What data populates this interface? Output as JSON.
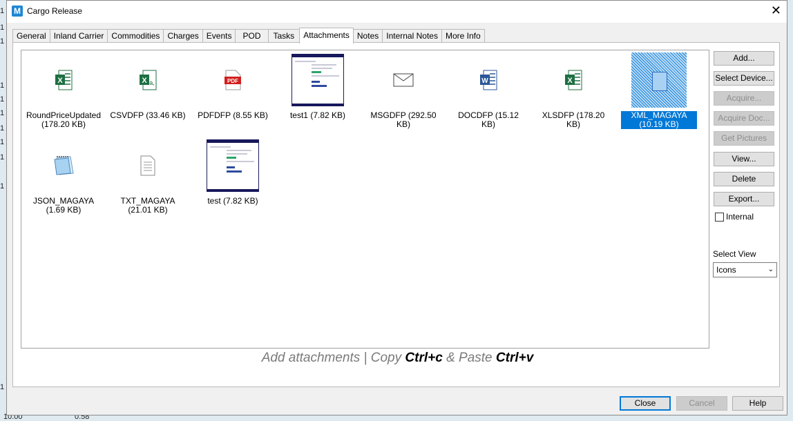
{
  "window": {
    "title": "Cargo Release",
    "app_icon": "M"
  },
  "tabs": [
    "General",
    "Inland Carrier",
    "Commodities",
    "Charges",
    "Events",
    "POD",
    "Tasks",
    "Attachments",
    "Notes",
    "Internal Notes",
    "More Info"
  ],
  "active_tab": "Attachments",
  "attachments": [
    {
      "label": "RoundPriceUpdated (178.20 KB)",
      "icon": "excel-icon"
    },
    {
      "label": "CSVDFP (33.46 KB)",
      "icon": "csv-icon"
    },
    {
      "label": "PDFDFP (8.55 KB)",
      "icon": "pdf-icon"
    },
    {
      "label": "test1 (7.82 KB)",
      "icon": "image-thumbnail"
    },
    {
      "label": "MSGDFP (292.50 KB)",
      "icon": "envelope-icon"
    },
    {
      "label": "DOCDFP (15.12 KB)",
      "icon": "word-icon"
    },
    {
      "label": "XLSDFP (178.20 KB)",
      "icon": "excel-icon"
    },
    {
      "label": "XML_MAGAYA (10.19 KB)",
      "icon": "xml-file-icon",
      "selected": true
    },
    {
      "label": "JSON_MAGAYA (1.69 KB)",
      "icon": "notepad-icon"
    },
    {
      "label": "TXT_MAGAYA (21.01 KB)",
      "icon": "text-file-icon"
    },
    {
      "label": "test (7.82 KB)",
      "icon": "image-thumbnail"
    }
  ],
  "side_buttons": {
    "add": "Add...",
    "select_device": "Select Device...",
    "acquire": "Acquire...",
    "acquire_doc": "Acquire Doc...",
    "get_pictures": "Get Pictures",
    "view": "View...",
    "delete": "Delete",
    "export": "Export..."
  },
  "internal_checkbox": {
    "label": "Internal",
    "checked": false
  },
  "select_view": {
    "label": "Select View",
    "value": "Icons"
  },
  "hint": {
    "part1": "Add attachments | Copy ",
    "key1": "Ctrl+c",
    "part2": " & Paste ",
    "key2": "Ctrl+v"
  },
  "footer": {
    "close": "Close",
    "cancel": "Cancel",
    "help": "Help"
  },
  "background": {
    "left_digits": [
      "1",
      "1",
      "1",
      "1",
      "1",
      "1",
      "1",
      "1",
      "1",
      "1",
      "1"
    ],
    "bottom_left": "10.00",
    "bottom_mid": "0.58"
  }
}
